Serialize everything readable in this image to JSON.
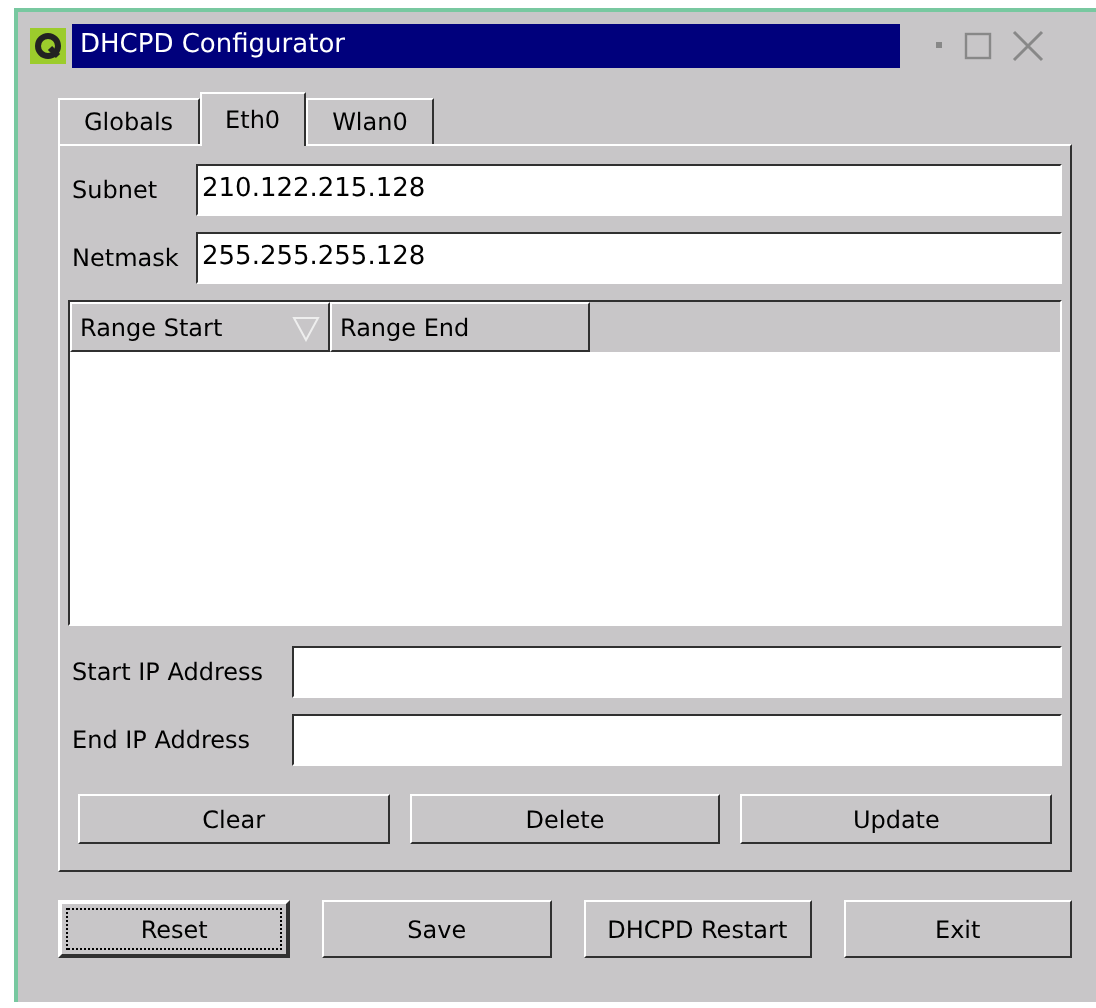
{
  "window": {
    "title": "DHCPD Configurator"
  },
  "tabs": [
    {
      "label": "Globals",
      "selected": false
    },
    {
      "label": "Eth0",
      "selected": true
    },
    {
      "label": "Wlan0",
      "selected": false
    }
  ],
  "fields": [
    {
      "label": "Subnet",
      "value": "210.122.215.128"
    },
    {
      "label": "Netmask",
      "value": "255.255.255.128"
    }
  ],
  "table": {
    "columns": [
      {
        "label": "Range Start",
        "sorted": true
      },
      {
        "label": "Range End",
        "sorted": false
      }
    ]
  },
  "range_fields": [
    {
      "label": "Start IP Address"
    },
    {
      "label": "End IP Address"
    }
  ],
  "range_buttons": [
    "Clear",
    "Delete",
    "Update"
  ],
  "buttons": [
    {
      "label": "Reset",
      "focused": true
    },
    {
      "label": "Save",
      "focused": false
    },
    {
      "label": "DHCPD Restart",
      "focused": false
    },
    {
      "label": "Exit",
      "focused": false
    }
  ]
}
